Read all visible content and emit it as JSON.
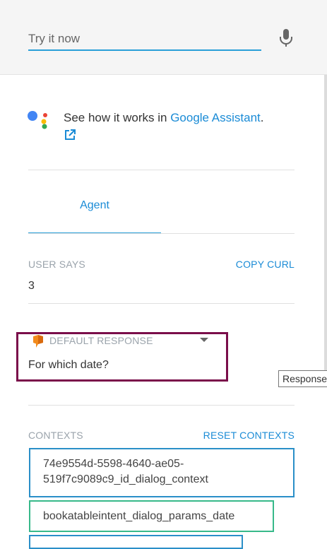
{
  "search": {
    "placeholder": "Try it now"
  },
  "assistant": {
    "text_prefix": "See how it works in ",
    "link_text": "Google Assistant",
    "text_suffix": "."
  },
  "tabs": [
    {
      "label": "Agent"
    }
  ],
  "user_says": {
    "label": "USER SAYS",
    "copy_label": "COPY CURL",
    "value": "3"
  },
  "default_response": {
    "label": "DEFAULT RESPONSE",
    "value": "For which date?"
  },
  "tooltip": {
    "text": "Response"
  },
  "contexts": {
    "label": "CONTEXTS",
    "reset_label": "RESET CONTEXTS",
    "items": [
      "74e9554d-5598-4640-ae05-519f7c9089c9_id_dialog_context",
      "bookatableintent_dialog_params_date",
      ""
    ]
  },
  "colors": {
    "accent": "#1a8bd6",
    "highlight_border": "#7a0e4a",
    "context_green": "#37b98a"
  }
}
